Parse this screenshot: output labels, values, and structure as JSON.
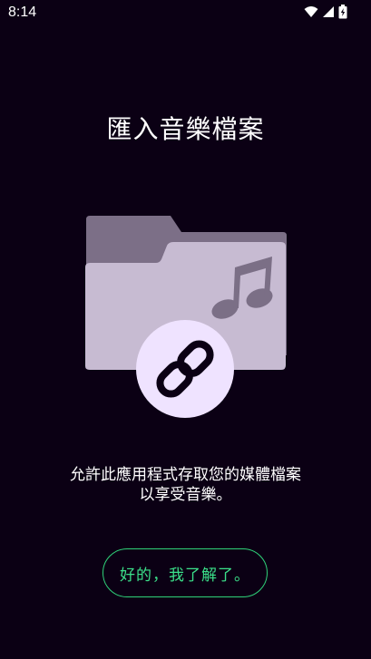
{
  "status_bar": {
    "time": "8:14",
    "icons": [
      "wifi-icon",
      "cellular-signal-icon",
      "battery-charging-icon"
    ]
  },
  "title": "匯入音樂檔案",
  "description": {
    "line1": "允許此應用程式存取您的媒體檔案",
    "line2": "以享受音樂。"
  },
  "ok_button": {
    "label": "好的，我了解了。"
  },
  "illustration": {
    "icons": [
      "folder-icon",
      "music-note-icon",
      "link-icon"
    ]
  },
  "colors": {
    "background": "#0b0014",
    "accent": "#3be08a",
    "folder_back": "#7c6f87",
    "folder_front": "#c7bbd2",
    "link_circle": "#efe3ff"
  }
}
